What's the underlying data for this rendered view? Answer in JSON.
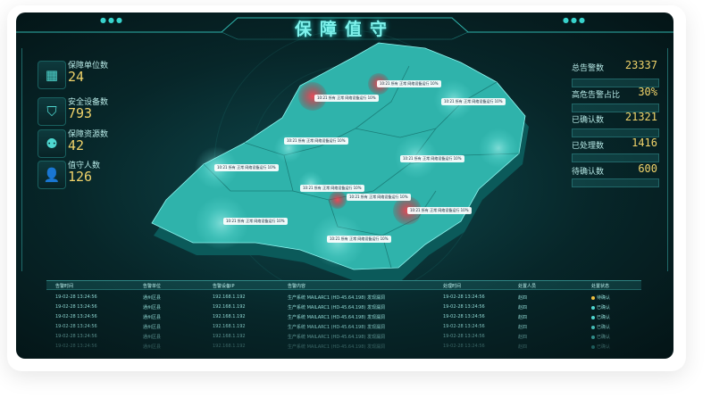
{
  "title": "保障值守",
  "left_stats": [
    {
      "label": "保障单位数",
      "value": "24",
      "icon": "building-icon"
    },
    {
      "label": "安全设备数",
      "value": "793",
      "icon": "shield-icon"
    },
    {
      "label": "保障资源数",
      "value": "42",
      "icon": "resource-icon"
    },
    {
      "label": "值守人数",
      "value": "126",
      "icon": "person-icon"
    }
  ],
  "right_stats": [
    {
      "label": "总告警数",
      "value": "23337"
    },
    {
      "label": "高危告警占比",
      "value": "30%"
    },
    {
      "label": "已确认数",
      "value": "21321"
    },
    {
      "label": "已处理数",
      "value": "1416"
    },
    {
      "label": "待确认数",
      "value": "600"
    }
  ],
  "map_labels": [
    "10:21 所有 正常 网络设备运行 10%",
    "10:21 所有 正常 网络设备运行 10%",
    "10:21 所有 正常 网络设备运行 10%",
    "10:21 所有 正常 网络设备运行 10%",
    "10:21 所有 正常 网络设备运行 10%",
    "10:21 所有 正常 网络设备运行 10%",
    "10:21 所有 正常 网络设备运行 10%",
    "10:21 所有 正常 网络设备运行 10%",
    "10:21 所有 正常 网络设备运行 10%",
    "10:21 所有 正常 网络设备运行 10%",
    "10:21 所有 正常 网络设备运行 10%"
  ],
  "table": {
    "headers": [
      "告警时间",
      "告警单位",
      "告警设备IP",
      "告警内容",
      "处理时间",
      "处置人员",
      "处置状态"
    ],
    "rows": [
      {
        "time": "19-02-28 13:24:56",
        "unit": "通州区县",
        "ip": "192.168.1.192",
        "content": "生产系统  MAILARC1 (HD-45.64.198) 发现漏洞",
        "ptime": "19-02-28 13:24:56",
        "person": "赵四",
        "status": "待确认",
        "color": "#f0c040"
      },
      {
        "time": "19-02-28 13:24:56",
        "unit": "通州区县",
        "ip": "192.168.1.192",
        "content": "生产系统  MAILARC1 (HD-45.64.198) 发现漏洞",
        "ptime": "19-02-28 13:24:56",
        "person": "赵四",
        "status": "已确认",
        "color": "#4fd7d0"
      },
      {
        "time": "19-02-28 13:24:56",
        "unit": "通州区县",
        "ip": "192.168.1.192",
        "content": "生产系统  MAILARC1 (HD-45.64.198) 发现漏洞",
        "ptime": "19-02-28 13:24:56",
        "person": "赵四",
        "status": "已确认",
        "color": "#4fd7d0"
      },
      {
        "time": "19-02-28 13:24:56",
        "unit": "通州区县",
        "ip": "192.168.1.192",
        "content": "生产系统  MAILARC1 (HD-45.64.198) 发现漏洞",
        "ptime": "19-02-28 13:24:56",
        "person": "赵四",
        "status": "已确认",
        "color": "#4fd7d0"
      },
      {
        "time": "19-02-28 13:24:56",
        "unit": "通州区县",
        "ip": "192.168.1.192",
        "content": "生产系统  MAILARC1 (HD-45.64.198) 发现漏洞",
        "ptime": "19-02-28 13:24:56",
        "person": "赵四",
        "status": "已确认",
        "color": "#4fd7d0"
      },
      {
        "time": "19-02-28 13:24:56",
        "unit": "通州区县",
        "ip": "192.168.1.192",
        "content": "生产系统  MAILARC1 (HD-45.64.198) 发现漏洞",
        "ptime": "19-02-28 13:24:56",
        "person": "赵四",
        "status": "已确认",
        "color": "#4fd7d0"
      }
    ]
  },
  "colors": {
    "accent": "#4fd7d0",
    "value": "#f0d36a",
    "alert": "#e0303a",
    "map": "#2fb3ab"
  }
}
